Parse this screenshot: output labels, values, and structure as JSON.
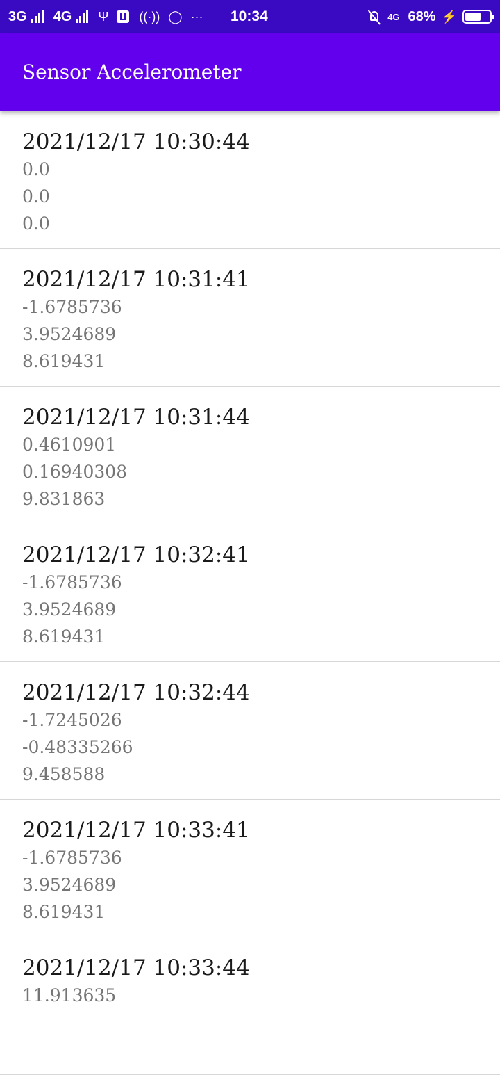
{
  "status_bar": {
    "network_1": "3G",
    "network_2": "4G",
    "time": "10:34",
    "network_right": "4G",
    "battery_percent": "68%",
    "battery_level": 0.68,
    "icons": [
      "signal-icon",
      "usb-icon",
      "debug-icon",
      "hotspot-icon",
      "whatsapp-icon",
      "more-icon",
      "notifications-off-icon",
      "charging-icon",
      "battery-icon"
    ]
  },
  "app_bar": {
    "title": "Sensor Accelerometer",
    "color": "#6200ee"
  },
  "entries": [
    {
      "date": "2021/12/17 10:30:44",
      "x": "0.0",
      "y": "0.0",
      "z": "0.0"
    },
    {
      "date": "2021/12/17 10:31:41",
      "x": "-1.6785736",
      "y": "3.9524689",
      "z": "8.619431"
    },
    {
      "date": "2021/12/17 10:31:44",
      "x": "0.4610901",
      "y": "0.16940308",
      "z": "9.831863"
    },
    {
      "date": "2021/12/17 10:32:41",
      "x": "-1.6785736",
      "y": "3.9524689",
      "z": "8.619431"
    },
    {
      "date": "2021/12/17 10:32:44",
      "x": "-1.7245026",
      "y": "-0.48335266",
      "z": "9.458588"
    },
    {
      "date": "2021/12/17 10:33:41",
      "x": "-1.6785736",
      "y": "3.9524689",
      "z": "8.619431"
    },
    {
      "date": "2021/12/17 10:33:44",
      "x": "11.913635",
      "y": "",
      "z": ""
    }
  ]
}
